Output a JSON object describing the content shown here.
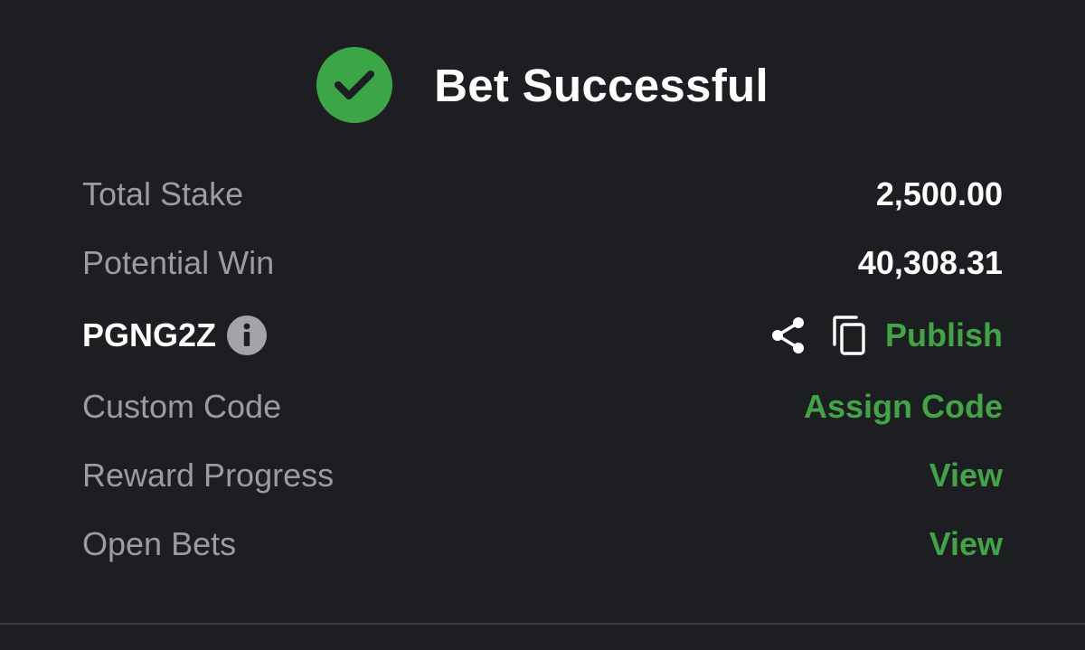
{
  "header": {
    "title": "Bet Successful",
    "icon": "check-circle-icon"
  },
  "summary": {
    "total_stake_label": "Total Stake",
    "total_stake_value": "2,500.00",
    "potential_win_label": "Potential Win",
    "potential_win_value": "40,308.31"
  },
  "booking": {
    "code": "PGNG2Z",
    "publish_label": "Publish",
    "icons": [
      "info-icon",
      "share-icon",
      "copy-icon"
    ]
  },
  "actions": {
    "custom_code_label": "Custom Code",
    "assign_code_label": "Assign Code",
    "reward_progress_label": "Reward Progress",
    "reward_view_label": "View",
    "open_bets_label": "Open Bets",
    "open_bets_view_label": "View"
  },
  "colors": {
    "background": "#1d1e22",
    "accent": "#43a347",
    "label": "#9b9ca2",
    "value": "#ffffff"
  }
}
